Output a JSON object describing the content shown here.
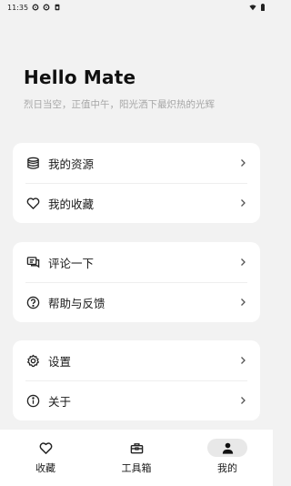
{
  "status": {
    "time": "11:35"
  },
  "header": {
    "title": "Hello Mate",
    "subtitle": "烈日当空，正值中午，阳光洒下最炽热的光辉"
  },
  "groups": [
    {
      "items": [
        {
          "label": "我的资源",
          "icon": "database-icon"
        },
        {
          "label": "我的收藏",
          "icon": "heart-icon"
        }
      ]
    },
    {
      "items": [
        {
          "label": "评论一下",
          "icon": "comment-icon"
        },
        {
          "label": "帮助与反馈",
          "icon": "help-icon"
        }
      ]
    },
    {
      "items": [
        {
          "label": "设置",
          "icon": "gear-icon"
        },
        {
          "label": "关于",
          "icon": "info-icon"
        }
      ]
    }
  ],
  "nav": [
    {
      "label": "收藏",
      "icon": "heart-icon",
      "active": false
    },
    {
      "label": "工具箱",
      "icon": "toolbox-icon",
      "active": false
    },
    {
      "label": "我的",
      "icon": "person-icon",
      "active": true
    }
  ]
}
